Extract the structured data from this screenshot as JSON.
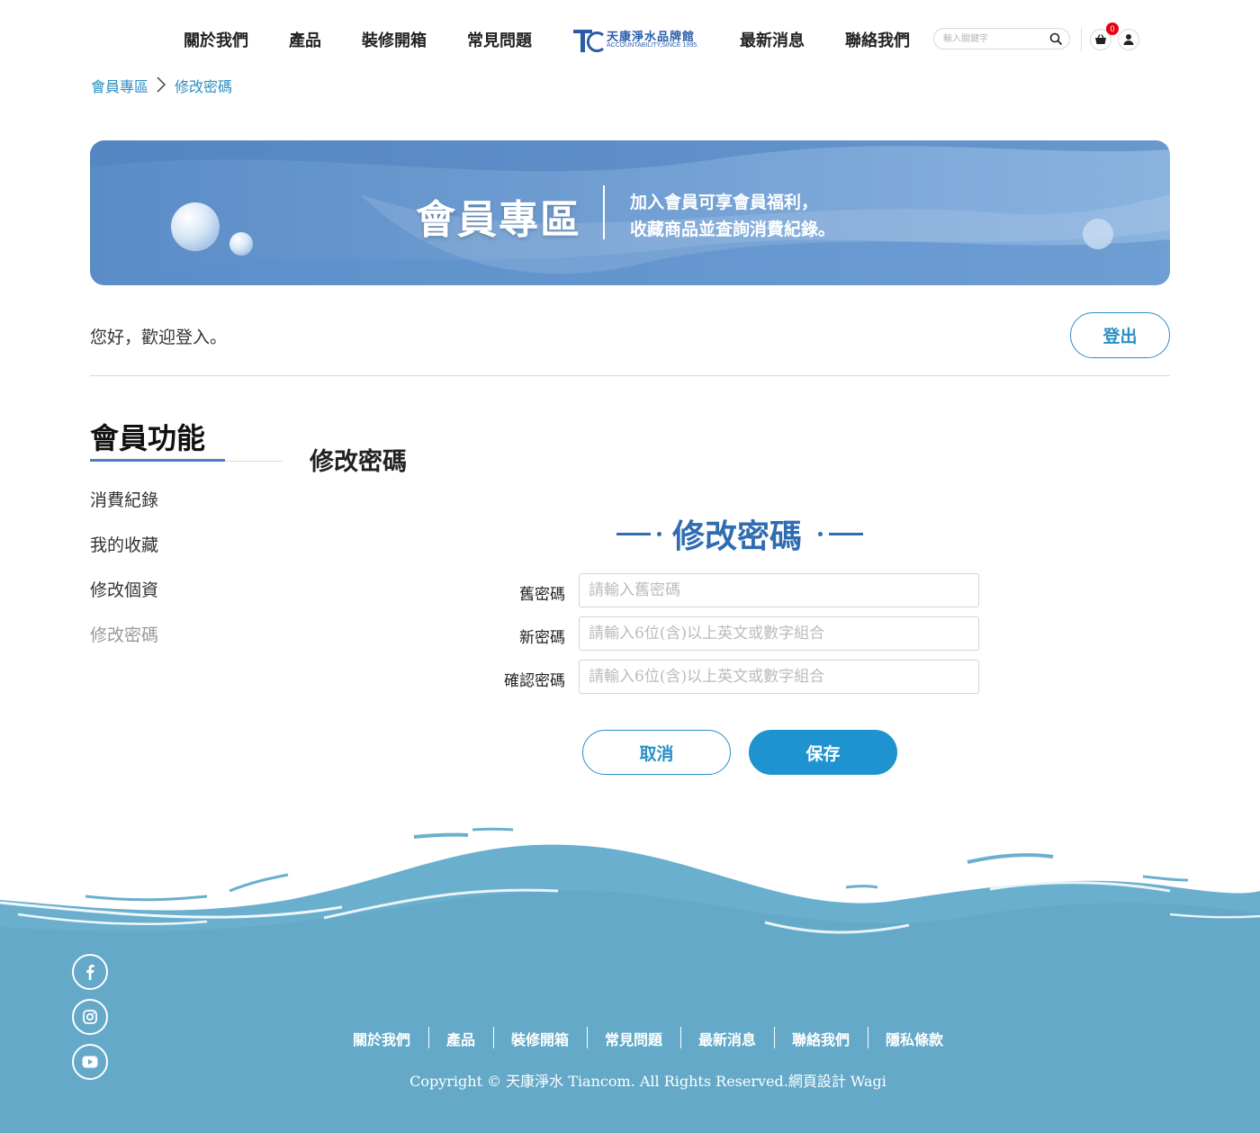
{
  "header": {
    "nav_left": [
      "關於我們",
      "產品",
      "裝修開箱",
      "常見問題"
    ],
    "nav_right": [
      "最新消息",
      "聯絡我們"
    ],
    "logo": {
      "chinese_name": "天康淨水品牌館",
      "tagline": "ACCOUNTABILITY,SINCE 1995.",
      "mark": "TC"
    },
    "search": {
      "placeholder": "輸入關鍵字",
      "icon": "search-icon"
    },
    "cart": {
      "icon": "basket-icon",
      "count": "0"
    },
    "user": {
      "icon": "user-icon"
    }
  },
  "breadcrumb": [
    "會員專區",
    "修改密碼"
  ],
  "banner": {
    "title": "會員專區",
    "subtitle_line1": "加入會員可享會員福利，",
    "subtitle_line2": "收藏商品並查詢消費紀錄。"
  },
  "welcome": {
    "text": "您好，歡迎登入。",
    "logout_label": "登出"
  },
  "sidebar": {
    "title": "會員功能",
    "items": [
      {
        "label": "消費紀錄",
        "active": false
      },
      {
        "label": "我的收藏",
        "active": false
      },
      {
        "label": "修改個資",
        "active": false
      },
      {
        "label": "修改密碼",
        "active": true
      }
    ]
  },
  "main": {
    "page_title": "修改密碼",
    "form_heading": "修改密碼",
    "fields": [
      {
        "label": "舊密碼",
        "placeholder": "請輸入舊密碼",
        "value": ""
      },
      {
        "label": "新密碼",
        "placeholder": "請輸入6位(含)以上英文或數字組合",
        "value": ""
      },
      {
        "label": "確認密碼",
        "placeholder": "請輸入6位(含)以上英文或數字組合",
        "value": ""
      }
    ],
    "cancel_label": "取消",
    "save_label": "保存"
  },
  "footer": {
    "social": [
      "facebook-icon",
      "instagram-icon",
      "youtube-icon"
    ],
    "links": [
      "關於我們",
      "產品",
      "裝修開箱",
      "常見問題",
      "最新消息",
      "聯絡我們",
      "隱私條款"
    ],
    "copyright": "Copyright © 天康淨水 Tiancom. All Rights Reserved.網頁設計 Wagi"
  },
  "colors": {
    "accent": "#2a8fc4",
    "heading_blue": "#2f6db0",
    "save_button": "#1f93cf",
    "footer_water": "#6aafcd",
    "badge": "#e60012"
  }
}
